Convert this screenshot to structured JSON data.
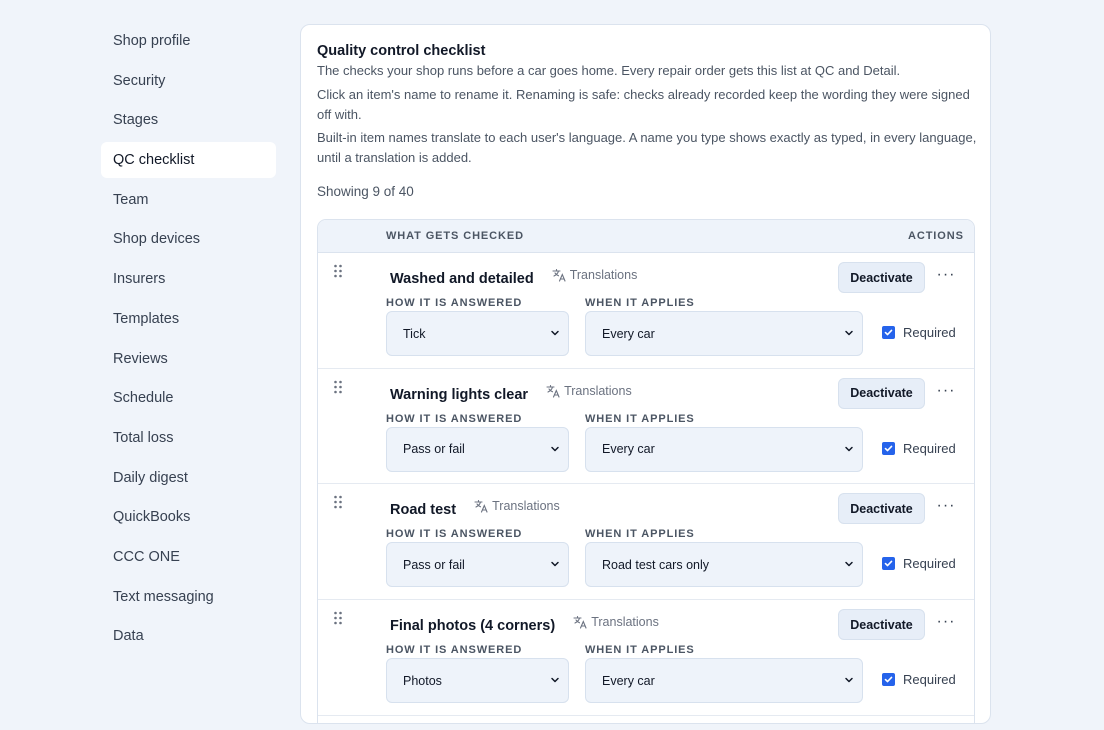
{
  "sidebar": {
    "items": [
      {
        "label": "Shop profile",
        "active": false
      },
      {
        "label": "Security",
        "active": false
      },
      {
        "label": "Stages",
        "active": false
      },
      {
        "label": "QC checklist",
        "active": true
      },
      {
        "label": "Team",
        "active": false
      },
      {
        "label": "Shop devices",
        "active": false
      },
      {
        "label": "Insurers",
        "active": false
      },
      {
        "label": "Templates",
        "active": false
      },
      {
        "label": "Reviews",
        "active": false
      },
      {
        "label": "Schedule",
        "active": false
      },
      {
        "label": "Total loss",
        "active": false
      },
      {
        "label": "Daily digest",
        "active": false
      },
      {
        "label": "QuickBooks",
        "active": false
      },
      {
        "label": "CCC ONE",
        "active": false
      },
      {
        "label": "Text messaging",
        "active": false
      },
      {
        "label": "Data",
        "active": false
      }
    ]
  },
  "main": {
    "title": "Quality control checklist",
    "desc1": "The checks your shop runs before a car goes home. Every repair order gets this list at QC and Detail.",
    "desc2": "Click an item's name to rename it. Renaming is safe: checks already recorded keep the wording they were signed off with.",
    "desc3": "Built-in item names translate to each user's language. A name you type shows exactly as typed, in every language, until a translation is added.",
    "showing": "Showing 9 of 40",
    "table": {
      "col_what": "WHAT GETS CHECKED",
      "col_actions": "ACTIONS",
      "label_how": "HOW IT IS ANSWERED",
      "label_when": "WHEN IT APPLIES",
      "translations_label": "Translations",
      "deactivate_label": "Deactivate",
      "required_label": "Required",
      "more_label": "···",
      "rows": [
        {
          "name": "Washed and detailed",
          "how": "Tick",
          "when": "Every car",
          "required": true
        },
        {
          "name": "Warning lights clear",
          "how": "Pass or fail",
          "when": "Every car",
          "required": true
        },
        {
          "name": "Road test",
          "how": "Pass or fail",
          "when": "Road test cars only",
          "required": true
        },
        {
          "name": "Final photos (4 corners)",
          "how": "Photos",
          "when": "Every car",
          "required": true
        }
      ]
    }
  },
  "icons": {
    "drag": "drag-handle-icon",
    "translate": "translate-icon",
    "chevron": "chevron-down-icon",
    "more": "more-horizontal-icon",
    "check": "checkmark-icon"
  },
  "colors": {
    "page_bg": "#f0f4fa",
    "accent": "#2563eb",
    "button_bg": "#e7eef8",
    "header_bg": "#eef3fa"
  }
}
